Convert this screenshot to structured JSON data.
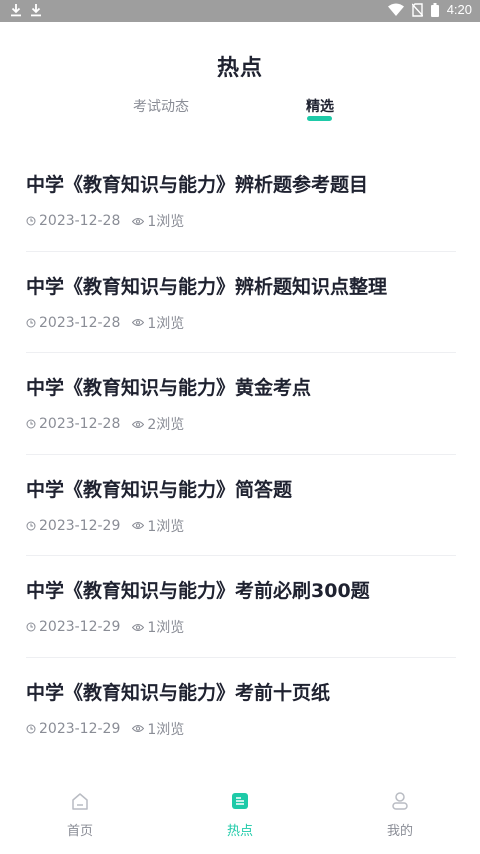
{
  "status_bar": {
    "time": "4:20",
    "left_icons": [
      "download-icon",
      "download-icon"
    ],
    "right_icons": [
      "wifi-icon",
      "no-sim-icon",
      "battery-icon"
    ]
  },
  "header": {
    "title": "热点"
  },
  "tabs": [
    {
      "label": "考试动态",
      "active": false
    },
    {
      "label": "精选",
      "active": true
    }
  ],
  "articles": [
    {
      "title": "中学《教育知识与能力》辨析题参考题目",
      "date": "2023-12-28",
      "views": "1浏览"
    },
    {
      "title": "中学《教育知识与能力》辨析题知识点整理",
      "date": "2023-12-28",
      "views": "1浏览"
    },
    {
      "title": "中学《教育知识与能力》黄金考点",
      "date": "2023-12-28",
      "views": "2浏览"
    },
    {
      "title": "中学《教育知识与能力》简答题",
      "date": "2023-12-29",
      "views": "1浏览"
    },
    {
      "title": "中学《教育知识与能力》考前必刷300题",
      "date": "2023-12-29",
      "views": "1浏览"
    },
    {
      "title": "中学《教育知识与能力》考前十页纸",
      "date": "2023-12-29",
      "views": "1浏览"
    }
  ],
  "bottom_nav": [
    {
      "label": "首页",
      "icon": "home-icon",
      "active": false
    },
    {
      "label": "热点",
      "icon": "document-icon",
      "active": true
    },
    {
      "label": "我的",
      "icon": "user-icon",
      "active": false
    }
  ],
  "colors": {
    "accent": "#1ecaa8",
    "title_text": "#1f2230",
    "muted_text": "#8a8d96",
    "status_bar": "#9e9e9e"
  }
}
